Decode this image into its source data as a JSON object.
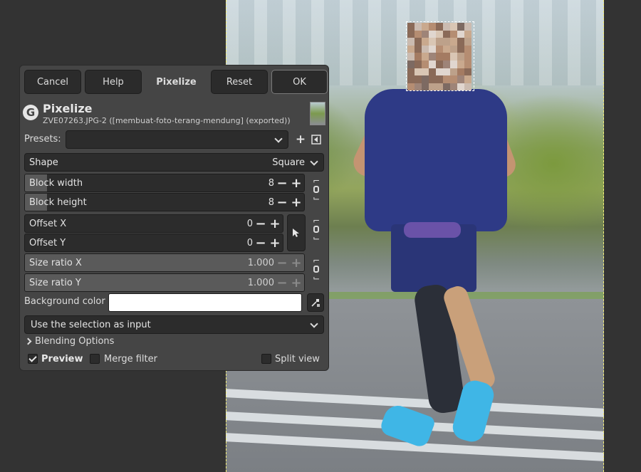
{
  "buttons": {
    "cancel": "Cancel",
    "help": "Help",
    "pixelize": "Pixelize",
    "reset": "Reset",
    "ok": "OK"
  },
  "header": {
    "title": "Pixelize",
    "subtitle": "ZVE07263.JPG-2 ([membuat-foto-terang-mendung] (exported))",
    "logo_glyph": "G"
  },
  "presets": {
    "label": "Presets:",
    "value": ""
  },
  "shape": {
    "label": "Shape",
    "value": "Square"
  },
  "block_width": {
    "label": "Block width",
    "value": "8",
    "fill_fraction": 0.08
  },
  "block_height": {
    "label": "Block height",
    "value": "8",
    "fill_fraction": 0.08
  },
  "offset_x": {
    "label": "Offset X",
    "value": "0"
  },
  "offset_y": {
    "label": "Offset Y",
    "value": "0"
  },
  "size_ratio_x": {
    "label": "Size ratio X",
    "value": "1.000",
    "fill_fraction": 1.0
  },
  "size_ratio_y": {
    "label": "Size ratio Y",
    "value": "1.000",
    "fill_fraction": 1.0
  },
  "background_color": {
    "label": "Background color",
    "value": "#ffffff"
  },
  "selection_mode": {
    "value": "Use the selection as input"
  },
  "blending_options": "Blending Options",
  "preview": {
    "label": "Preview",
    "checked": true
  },
  "merge_filter": {
    "label": "Merge filter",
    "checked": false
  },
  "split_view": {
    "label": "Split view",
    "checked": false
  },
  "icons": {
    "add_preset": "plus-icon",
    "manage_presets": "menu-left-icon",
    "chain": "chain-icon",
    "pointer": "pointer-icon",
    "eyedropper": "eyedropper-icon",
    "expander": "chevron-right-icon"
  }
}
